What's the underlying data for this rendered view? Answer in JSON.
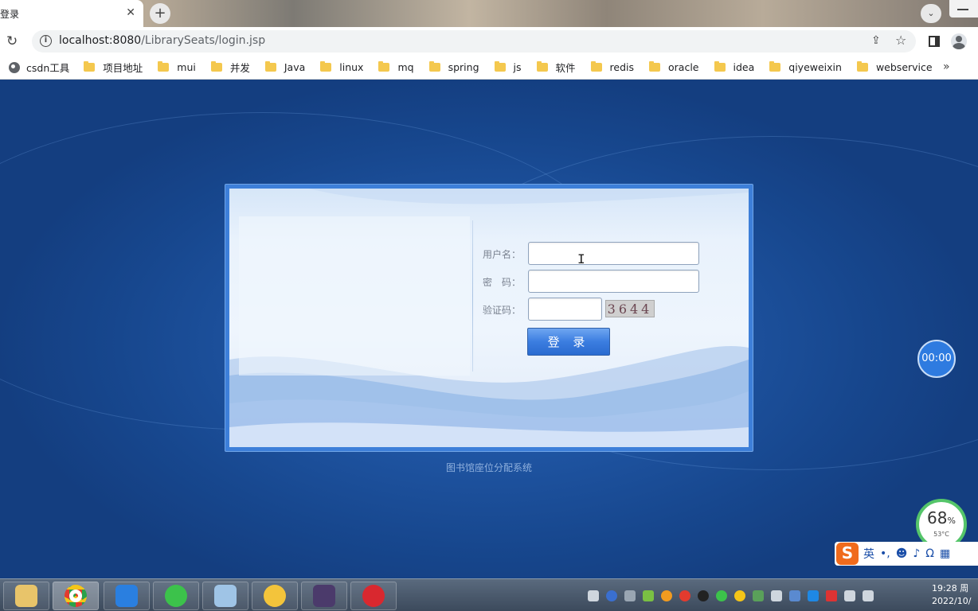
{
  "tab": {
    "title": "登录",
    "close": "✕"
  },
  "toolbar": {
    "url_host": "localhost:8080",
    "url_path": "/LibrarySeats/login.jsp"
  },
  "bookmarks": [
    {
      "label": "csdn工具",
      "type": "site"
    },
    {
      "label": "项目地址",
      "type": "folder"
    },
    {
      "label": "mui",
      "type": "folder"
    },
    {
      "label": "并发",
      "type": "folder"
    },
    {
      "label": "Java",
      "type": "folder"
    },
    {
      "label": "linux",
      "type": "folder"
    },
    {
      "label": "mq",
      "type": "folder"
    },
    {
      "label": "spring",
      "type": "folder"
    },
    {
      "label": "js",
      "type": "folder"
    },
    {
      "label": "软件",
      "type": "folder"
    },
    {
      "label": "redis",
      "type": "folder"
    },
    {
      "label": "oracle",
      "type": "folder"
    },
    {
      "label": "idea",
      "type": "folder"
    },
    {
      "label": "qiyeweixin",
      "type": "folder"
    },
    {
      "label": "webservice",
      "type": "folder"
    }
  ],
  "login": {
    "username_label": "用户名：",
    "username_value": "",
    "password_label": "密　码：",
    "password_value": "",
    "captcha_label": "验证码：",
    "captcha_value": "",
    "captcha_image_text": "3644",
    "submit_label": "登 录"
  },
  "footer": {
    "system_name": "图书馆座位分配系统"
  },
  "overlays": {
    "timer": "00:00",
    "cpu_percent": "68",
    "cpu_percent_unit": "%",
    "cpu_temp": "53°C",
    "ime_mode": "英"
  },
  "taskbar": {
    "clock_time": "19:28 周",
    "clock_date": "2022/10/"
  },
  "colors": {
    "accent": "#3b7de0",
    "page_bg": "#1f55a3",
    "folder": "#f4c84e"
  }
}
